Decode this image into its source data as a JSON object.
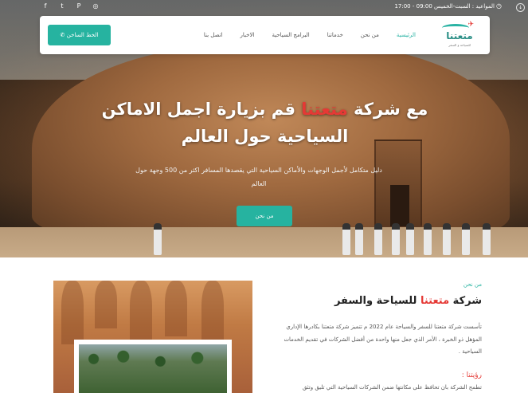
{
  "topbar": {
    "hours": "المواعيد : السبت-الخميس 09:00 - 17:00",
    "socials": [
      {
        "icon": "facebook-icon",
        "glyph": "f"
      },
      {
        "icon": "twitter-icon",
        "glyph": "t"
      },
      {
        "icon": "pinterest-icon",
        "glyph": "P"
      },
      {
        "icon": "instagram-icon",
        "glyph": "◎"
      }
    ]
  },
  "navbar": {
    "logo_name": "متعتنا",
    "logo_sub": "للسياحة و السفر",
    "items": [
      "الرئيسية",
      "من نحن",
      "خدماتنا",
      "البرامج السياحية",
      "الاخبار",
      "اتصل بنا"
    ],
    "active_index": 0,
    "hotline_label": "الخط الساخن"
  },
  "hero": {
    "title_prefix": "مع شركة ",
    "title_brand": "متعتنا",
    "title_suffix": " قم بزيارة اجمل الاماكن السياحية حول العالم",
    "description": "دليل متكامل لأجمل الوجهات والأماكن السياحية التي يقصدها المسافر اكثر من 500 وجهة حول العالم",
    "button_label": "من نحن"
  },
  "about": {
    "kicker": "من نحن",
    "title_prefix": "شركة ",
    "title_brand": "متعتنا",
    "title_suffix": " للسياحة والسفر",
    "text": "تأسست شركة متعتنا للسفر والسياحة عام 2022 م تتميز شركة متعتنا بكادرها الإداري المؤهل ذو الخبرة ، الأمر الذي جعل منها واحدة من أفضل الشركات في تقديم الخدمات السياحية .",
    "vision_title": "رؤيتنا :",
    "vision_text": "تطمح الشركة بأن تحافظ على مكانتها ضمن الشركات السياحية التي تليق وتثق"
  },
  "colors": {
    "accent": "#26b3a0",
    "brand_red": "#e53935"
  }
}
